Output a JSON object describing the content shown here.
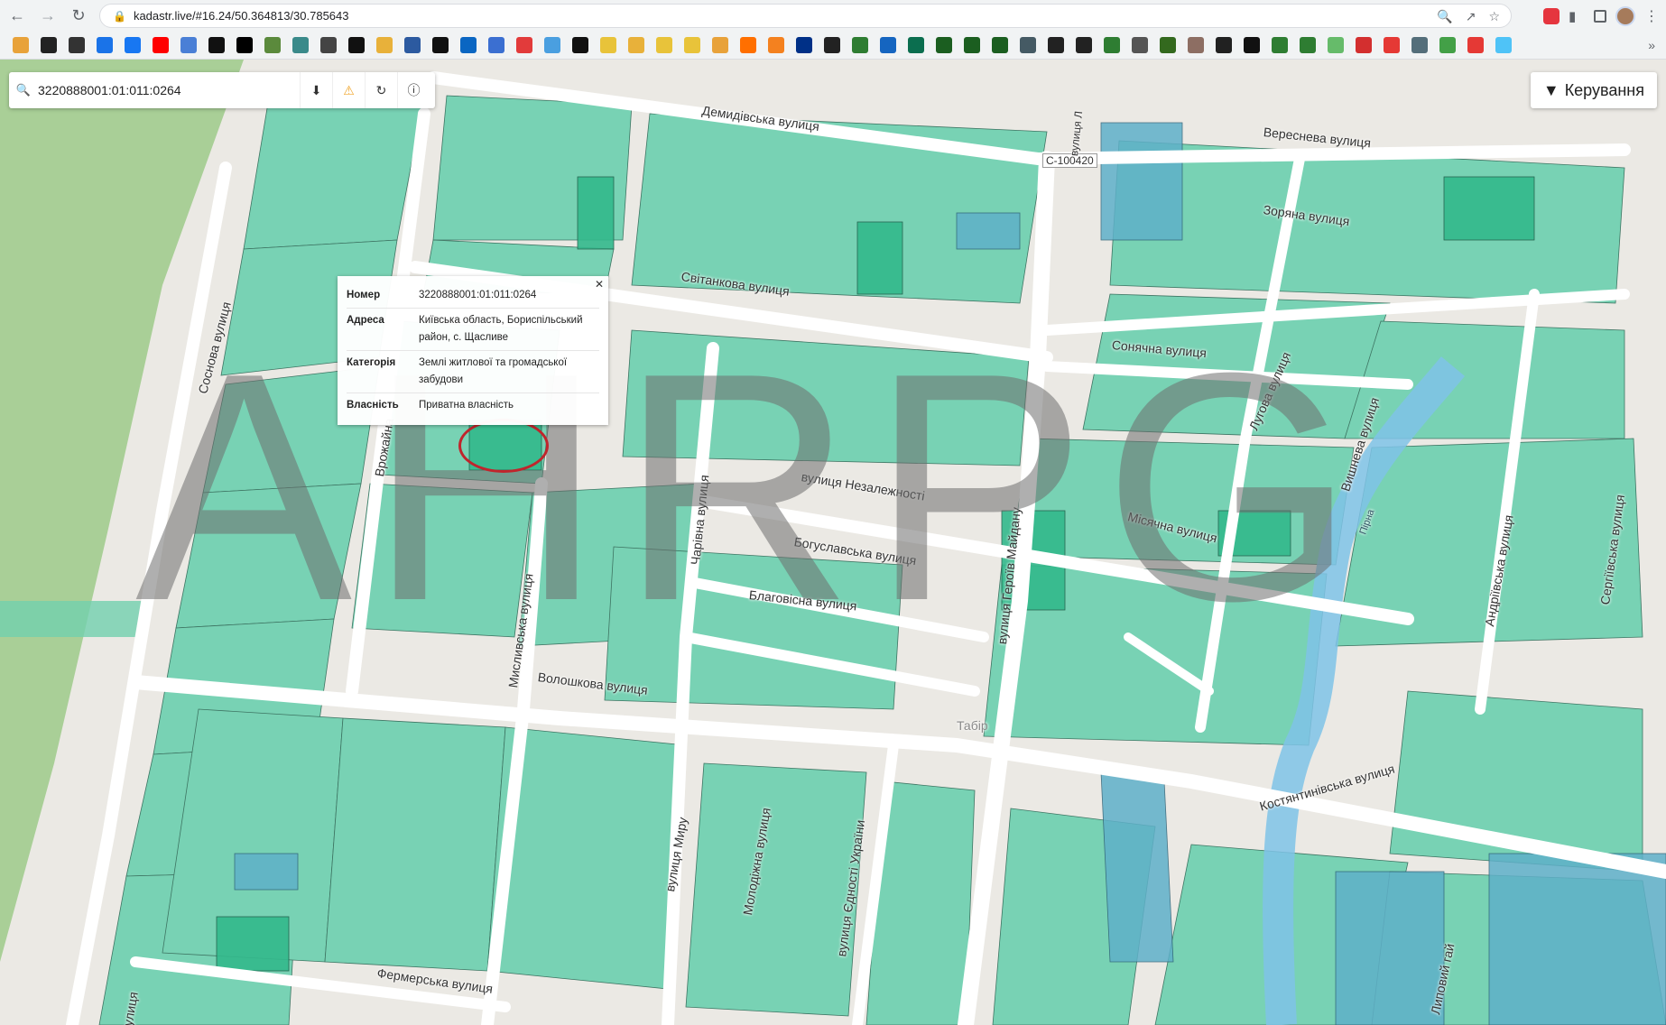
{
  "browser": {
    "url": "kadastr.live/#16.24/50.364813/30.785643",
    "back_icon": "arrow-left-icon",
    "forward_icon": "arrow-right-icon",
    "reload_icon": "reload-icon"
  },
  "bookmarks_count": 54,
  "search": {
    "value": "3220888001:01:011:0264"
  },
  "control": {
    "label": "Керування"
  },
  "popup": {
    "rows": [
      {
        "key": "Номер",
        "value": "3220888001:01:011:0264"
      },
      {
        "key": "Адреса",
        "value": "Київська область, Бориспільський район, с. Щасливе"
      },
      {
        "key": "Категорія",
        "value": "Землі житлової та громадської забудови"
      },
      {
        "key": "Власність",
        "value": "Приватна власність"
      }
    ]
  },
  "watermark": "AHRPG",
  "streets": [
    "Демидівська вулиця",
    "Вереснева вулиця",
    "С-100420",
    "Зоряна вулиця",
    "Світанкова вулиця",
    "Сонячна вулиця",
    "Лугова вулиця",
    "Соснова вулиця",
    "Врожайна",
    "вулиця Незалежності",
    "Чарівна вулиця",
    "вулиця Героїв Майдану",
    "Місячна вулиця",
    "Вишнева вулиця",
    "Богуславська вулиця",
    "Благовісна вулиця",
    "Мисливська вулиця",
    "Волошкова вулиця",
    "Табір",
    "Костянтинівська вулиця",
    "вулиця Миру",
    "Молодіжна вулиця",
    "вулиця Єдності України",
    "Фермерська вулиця",
    "Андріївська вулиця",
    "Сергіївська вулиця",
    "Липовий гай",
    "Пірна",
    "вулиця",
    "вулиця Л"
  ],
  "colors": {
    "parcel_fill": "#6fd1b0",
    "parcel_dark": "#33b98c",
    "parcel_blue": "#5fb0c9",
    "road": "#ffffff",
    "forest": "#a9cf97",
    "river": "#7fc3e8",
    "highlight_ring": "#c0252c"
  }
}
